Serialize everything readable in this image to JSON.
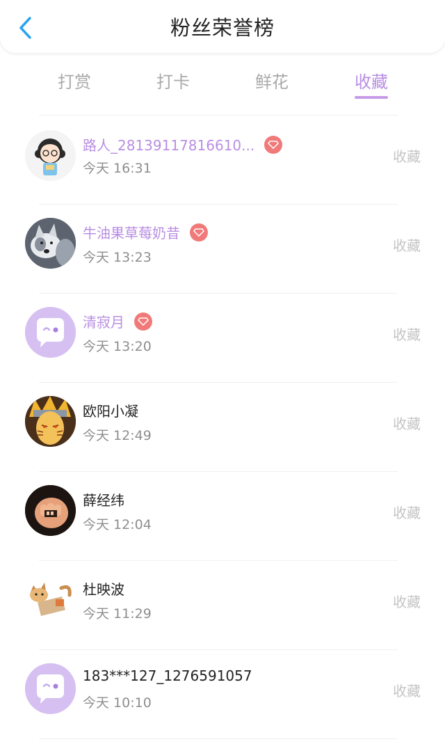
{
  "header": {
    "title": "粉丝荣誉榜",
    "back_icon": "chevron-left-icon"
  },
  "tabs": [
    {
      "label": "打赏",
      "active": false
    },
    {
      "label": "打卡",
      "active": false
    },
    {
      "label": "鲜花",
      "active": false
    },
    {
      "label": "收藏",
      "active": true
    }
  ],
  "colors": {
    "accent": "#b98ee3",
    "badge": "#f07a7a",
    "back": "#2aa3ef"
  },
  "fans": [
    {
      "name": "路人_28139117816610...",
      "time": "今天 16:31",
      "action": "收藏",
      "vip": true,
      "avatar": "cartoon-girl-avatar"
    },
    {
      "name": "牛油果草莓奶昔",
      "time": "今天 13:23",
      "action": "收藏",
      "vip": true,
      "avatar": "husky-dog-avatar"
    },
    {
      "name": "清寂月",
      "time": "今天 13:20",
      "action": "收藏",
      "vip": true,
      "avatar": "default-chat-avatar"
    },
    {
      "name": "欧阳小凝",
      "time": "今天 12:49",
      "action": "收藏",
      "vip": false,
      "avatar": "anime-ninja-avatar"
    },
    {
      "name": "薛经纬",
      "time": "今天 12:04",
      "action": "收藏",
      "vip": false,
      "avatar": "fist-avatar"
    },
    {
      "name": "杜映波",
      "time": "今天 11:29",
      "action": "收藏",
      "vip": false,
      "avatar": "cat-avatar"
    },
    {
      "name": "183***127_1276591057",
      "time": "今天 10:10",
      "action": "收藏",
      "vip": false,
      "avatar": "default-chat-avatar"
    }
  ]
}
